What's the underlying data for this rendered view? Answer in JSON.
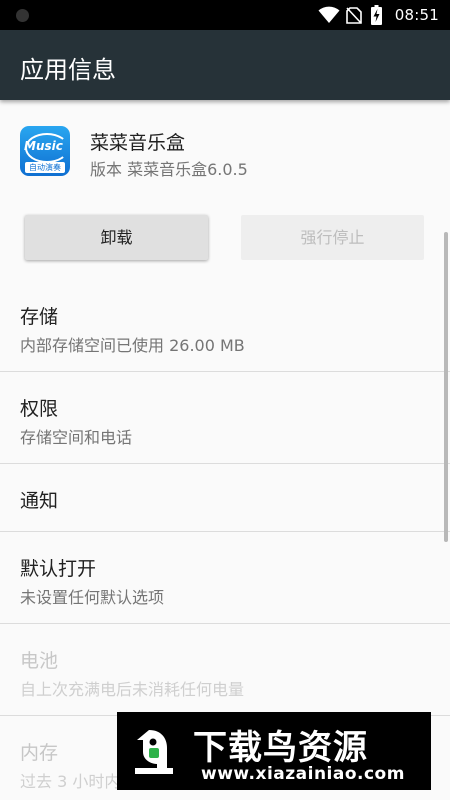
{
  "status_bar": {
    "time": "08:51",
    "icons": [
      "wifi-icon",
      "no-sim-icon",
      "battery-charging-icon"
    ]
  },
  "app_bar": {
    "title": "应用信息"
  },
  "app": {
    "name": "菜菜音乐盒",
    "version": "版本 菜菜音乐盒6.0.5",
    "icon_text": "Music",
    "icon_tag": "自动演奏"
  },
  "buttons": {
    "uninstall": "卸载",
    "force_stop": "强行停止"
  },
  "preferences": [
    {
      "title": "存储",
      "summary": "内部存储空间已使用 26.00 MB",
      "enabled": true
    },
    {
      "title": "权限",
      "summary": "存储空间和电话",
      "enabled": true
    },
    {
      "title": "通知",
      "summary": "",
      "enabled": true
    },
    {
      "title": "默认打开",
      "summary": "未设置任何默认选项",
      "enabled": true
    },
    {
      "title": "电池",
      "summary": "自上次充满电后未消耗任何电量",
      "enabled": false
    },
    {
      "title": "内存",
      "summary": "过去 3 小时内",
      "enabled": false
    }
  ],
  "watermark": {
    "title": "下载鸟资源",
    "url": "www.xiazainiao.com"
  },
  "colors": {
    "app_bar": "#263238",
    "status_bar": "#000000",
    "background": "#fafafa",
    "app_icon_accent": "#1a8be0"
  }
}
